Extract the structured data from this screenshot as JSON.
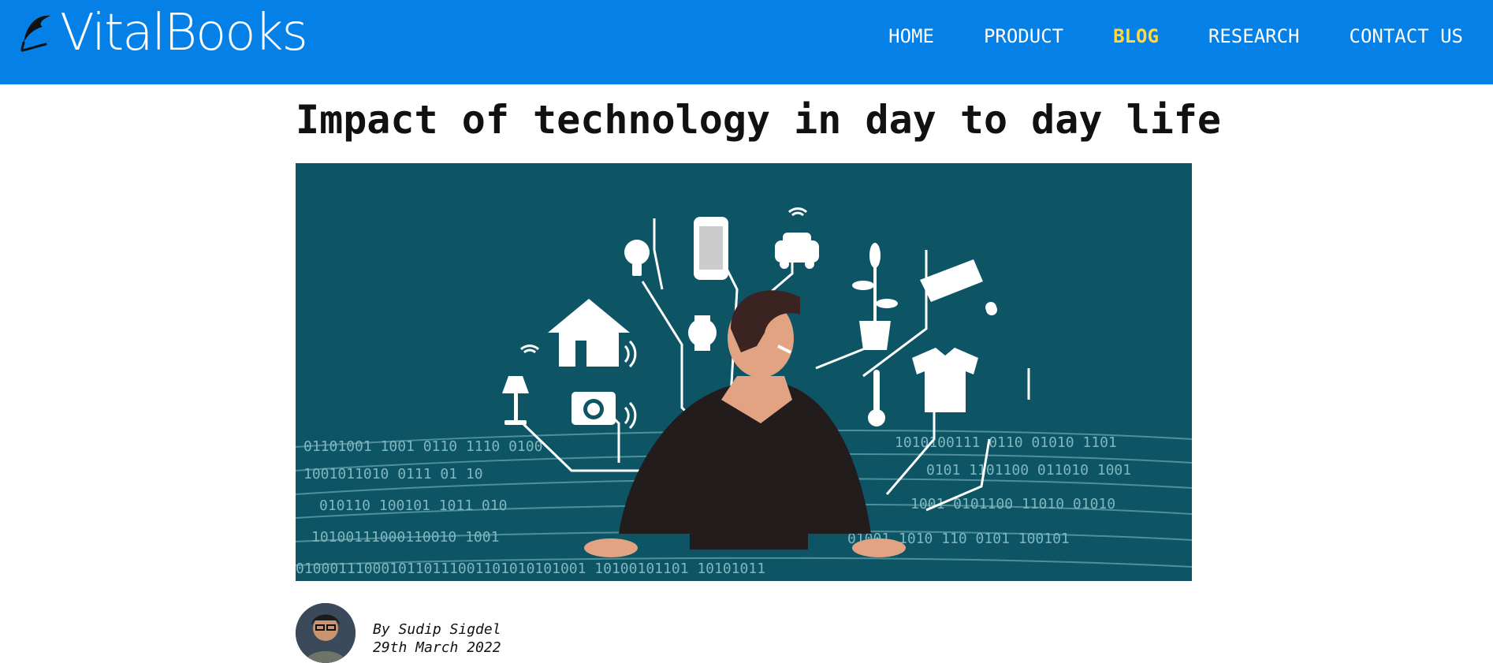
{
  "brand": {
    "name": "VitalBooks",
    "logo_icon": "quill-icon"
  },
  "nav": {
    "items": [
      {
        "label": "HOME",
        "active": false
      },
      {
        "label": "PRODUCT",
        "active": false
      },
      {
        "label": "BLOG",
        "active": true
      },
      {
        "label": "RESEARCH",
        "active": false
      },
      {
        "label": "CONTACT US",
        "active": false
      }
    ],
    "accent_active": "#ffd740",
    "background": "#0580e6"
  },
  "post": {
    "title": "Impact of technology in day to day life",
    "hero_icons": [
      "lamp-icon",
      "house-icon",
      "lightbulb-icon",
      "camera-icon",
      "smartwatch-icon",
      "smartphone-icon",
      "car-icon",
      "plant-icon",
      "thermometer-icon",
      "security-camera-icon",
      "tshirt-icon",
      "wifi-icon"
    ],
    "author_line": "By Sudip Sigdel",
    "date": "29th March 2022",
    "hero_background": "#0d5565"
  }
}
